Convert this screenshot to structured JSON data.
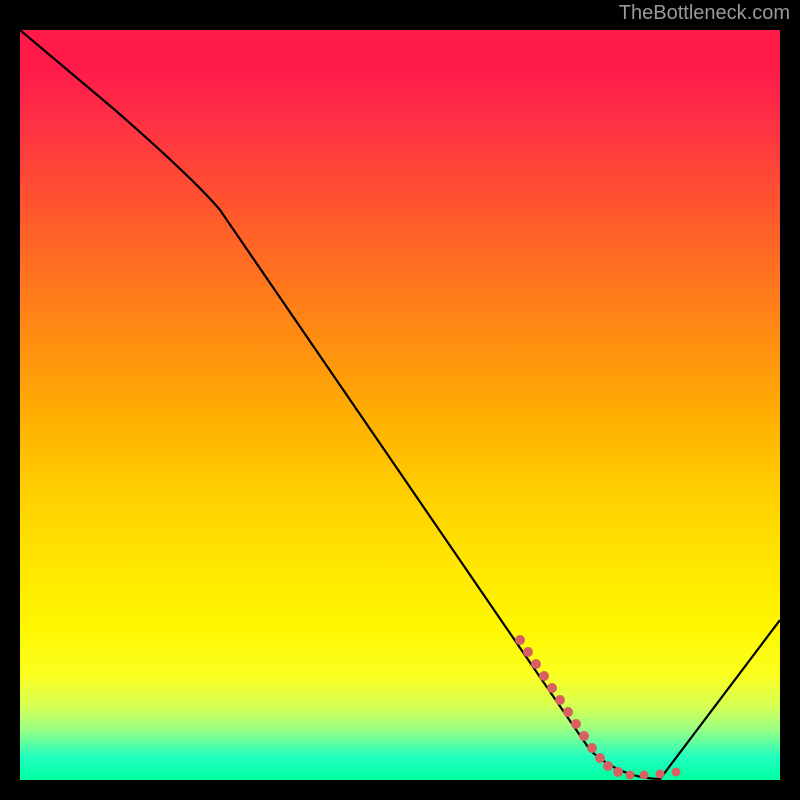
{
  "attribution": "TheBottleneck.com",
  "chart_data": {
    "type": "line",
    "title": "",
    "xlabel": "",
    "ylabel": "",
    "xlim": [
      0,
      100
    ],
    "ylim": [
      0,
      100
    ],
    "series": [
      {
        "name": "bottleneck-curve",
        "x": [
          0,
          25,
          78,
          84,
          100
        ],
        "y": [
          100,
          79,
          2,
          0,
          22
        ]
      }
    ],
    "markers": {
      "name": "dotted-segment",
      "color": "#d86060",
      "points": [
        {
          "x": 66,
          "y": 20
        },
        {
          "x": 68,
          "y": 17
        },
        {
          "x": 70,
          "y": 14
        },
        {
          "x": 72,
          "y": 11
        },
        {
          "x": 74,
          "y": 8
        },
        {
          "x": 76,
          "y": 5
        },
        {
          "x": 78,
          "y": 2.5
        },
        {
          "x": 79.5,
          "y": 1.2
        },
        {
          "x": 81,
          "y": 0.8
        },
        {
          "x": 83,
          "y": 0.6
        },
        {
          "x": 85,
          "y": 0.9
        }
      ]
    },
    "gradient": {
      "top": "#ff1a4a",
      "mid": "#ffe800",
      "bottom": "#00ff9f"
    }
  }
}
